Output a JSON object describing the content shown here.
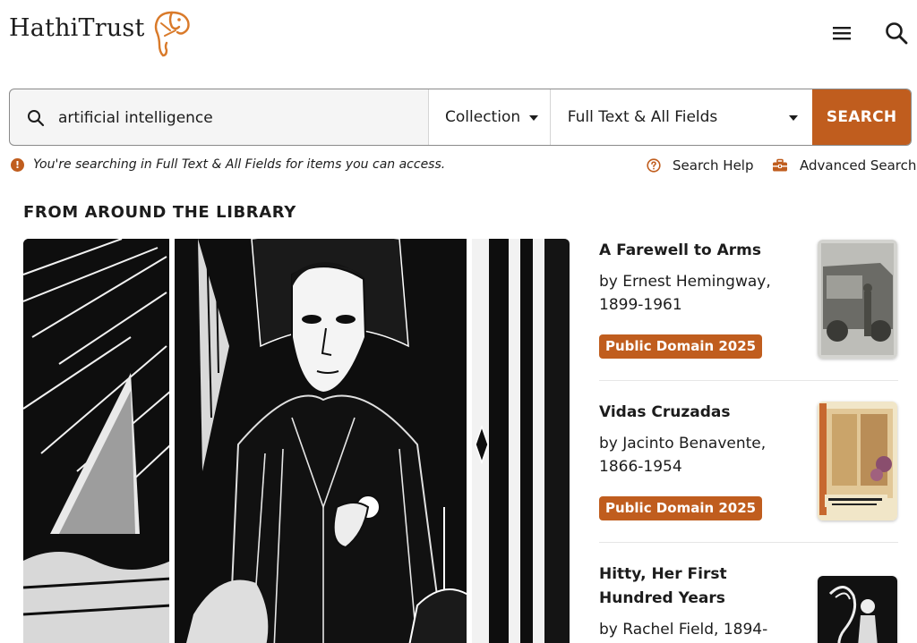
{
  "header": {
    "logo_text": "HathiTrust",
    "menu_icon": "hamburger-menu-icon",
    "search_icon": "search-icon"
  },
  "search": {
    "query": "artificial intelligence",
    "collection_label": "Collection",
    "fields_label": "Full Text & All Fields",
    "submit_label": "SEARCH"
  },
  "info": {
    "message": "You're searching in Full Text & All Fields for items you can access.",
    "search_help_label": "Search Help",
    "advanced_search_label": "Advanced Search"
  },
  "section": {
    "title": "FROM AROUND THE LIBRARY"
  },
  "books": [
    {
      "title": "A Farewell to Arms",
      "author": "by Ernest Hemingway, 1899-1961",
      "badge": "Public Domain 2025"
    },
    {
      "title": "Vidas Cruzadas",
      "author": "by Jacinto Benavente, 1866-1954",
      "badge": "Public Domain 2025"
    },
    {
      "title": "Hitty, Her First Hundred Years",
      "author": "by Rachel Field, 1894-",
      "badge": ""
    }
  ],
  "colors": {
    "accent": "#c05d1e",
    "text": "#1c1c1c",
    "searchbar_bg": "#f5f5f5"
  }
}
